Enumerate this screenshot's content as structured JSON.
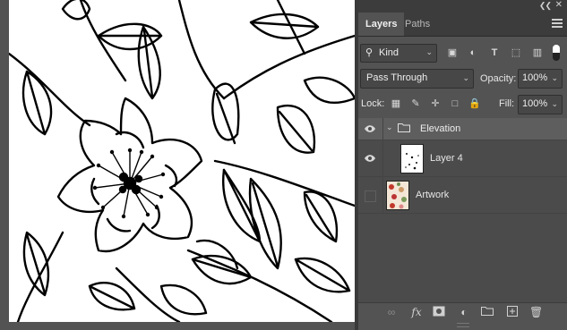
{
  "panel": {
    "tabs": [
      {
        "label": "Layers",
        "active": true
      },
      {
        "label": "Paths",
        "active": false
      }
    ],
    "filter": {
      "value": "Kind",
      "icons": [
        "image-filter-icon",
        "adjustment-filter-icon",
        "type-filter-icon",
        "shape-filter-icon",
        "smart-object-filter-icon"
      ]
    },
    "blend_mode": "Pass Through",
    "opacity_label": "Opacity:",
    "opacity_value": "100%",
    "lock_label": "Lock:",
    "fill_label": "Fill:",
    "fill_value": "100%",
    "layers": [
      {
        "name": "Elevation",
        "type": "group",
        "visible": true,
        "expanded": true,
        "selected": true
      },
      {
        "name": "Layer 4",
        "type": "pixel",
        "visible": true,
        "indent": true
      },
      {
        "name": "Artwork",
        "type": "pixel",
        "visible": false
      }
    ],
    "bottom_icons": [
      "link-layers-icon",
      "fx-icon",
      "add-mask-icon",
      "adjustment-layer-icon",
      "new-group-icon",
      "new-layer-icon",
      "delete-layer-icon"
    ],
    "fx_text": "fx"
  },
  "colors": {
    "panel_bg": "#535353",
    "selected_row": "#5e5e5e",
    "text": "#e6e6e6"
  }
}
